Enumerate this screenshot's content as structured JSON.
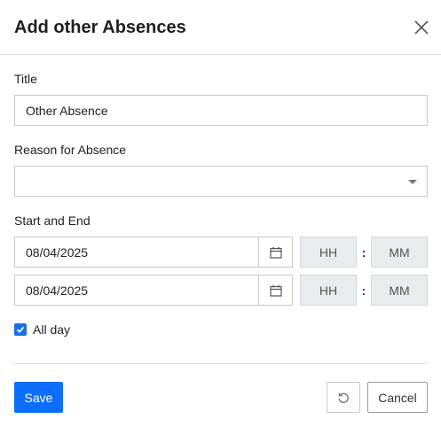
{
  "dialog": {
    "title": "Add other Absences"
  },
  "form": {
    "title_label": "Title",
    "title_value": "Other Absence",
    "reason_label": "Reason for Absence",
    "reason_value": "",
    "start_end_label": "Start and End",
    "start": {
      "date": "08/04/2025",
      "hour_placeholder": "HH",
      "minute_placeholder": "MM"
    },
    "end": {
      "date": "08/04/2025",
      "hour_placeholder": "HH",
      "minute_placeholder": "MM"
    },
    "time_separator": ":",
    "all_day_label": "All day",
    "all_day_checked": true
  },
  "footer": {
    "save_label": "Save",
    "cancel_label": "Cancel"
  },
  "colors": {
    "primary": "#0d6efd",
    "checkbox": "#1a6fe8",
    "time_box_bg": "#e9ecef",
    "border": "#c9c9c9"
  },
  "icons": {
    "close": "close-icon",
    "calendar": "calendar-icon",
    "dropdown": "chevron-down-icon",
    "check": "check-icon",
    "reset": "reset-icon"
  }
}
